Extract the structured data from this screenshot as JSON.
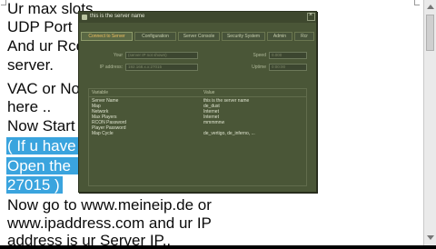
{
  "document": {
    "lines": [
      "Ur max slots",
      "UDP Port",
      "And ur Rcon",
      "server.",
      "VAC or No",
      "here ..",
      "Now Start",
      "( If u have",
      "Open the",
      "27015 )",
      "Now go to www.meineip.de or",
      "www.ipaddress.com and ur IP",
      "address is ur Server IP.."
    ],
    "selection_color": "#3aa4de"
  },
  "dialog": {
    "title": "this is the server name",
    "close_glyph": "×",
    "tabs": [
      "Connect to Server",
      "Configuration",
      "Server Console",
      "Security System",
      "Admin",
      "Rcr"
    ],
    "fields": {
      "ip_label": "Your",
      "ip_value": "(server IP not shown)",
      "ip_address_label": "IP address:",
      "ip_address_value": "192.168.x.x:27015",
      "speed_label": "Speed",
      "speed_value": "0.000",
      "uptime_label": "Uptime",
      "uptime_value": "0:00:00"
    },
    "table": {
      "headers": [
        "Variable",
        "Value"
      ],
      "rows": [
        {
          "variable": "Server Name",
          "value": "this is the server name"
        },
        {
          "variable": "Map",
          "value": "de_dust"
        },
        {
          "variable": "Network",
          "value": "Internet"
        },
        {
          "variable": "Max Players",
          "value": "Internet"
        },
        {
          "variable": "RCON Password",
          "value": "mmmmnw"
        },
        {
          "variable": "Player Password",
          "value": ""
        },
        {
          "variable": "Map Cycle",
          "value": "de_vertigo, de_inferno, ..."
        }
      ]
    }
  }
}
